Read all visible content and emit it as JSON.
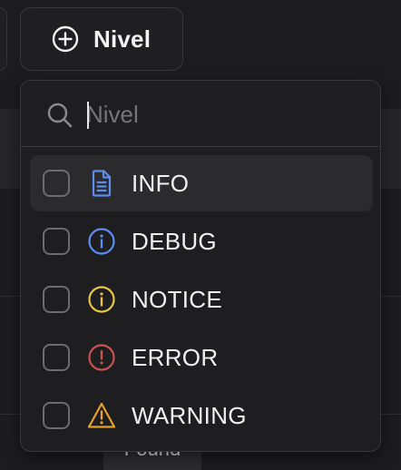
{
  "trigger": {
    "label": "Nivel",
    "icon": "plus-circle-icon"
  },
  "search": {
    "placeholder": "Nivel",
    "value": "",
    "icon": "search-icon"
  },
  "levels": [
    {
      "label": "INFO",
      "icon": "document-icon",
      "color": "#5b8def",
      "checked": false,
      "highlighted": true
    },
    {
      "label": "DEBUG",
      "icon": "info-circle-icon",
      "color": "#5b8def",
      "checked": false,
      "highlighted": false
    },
    {
      "label": "NOTICE",
      "icon": "info-circle-icon",
      "color": "#e8c547",
      "checked": false,
      "highlighted": false
    },
    {
      "label": "ERROR",
      "icon": "alert-circle-icon",
      "color": "#c9524f",
      "checked": false,
      "highlighted": false
    },
    {
      "label": "WARNING",
      "icon": "warning-triangle-icon",
      "color": "#e6a12a",
      "checked": false,
      "highlighted": false
    }
  ],
  "background": {
    "pill_text": "Found"
  },
  "colors": {
    "background": "#1c1c1e",
    "panel": "#1e1e20",
    "border": "#38383b",
    "highlight": "#2b2b2e",
    "text": "#f0f0f0",
    "placeholder": "#76767a"
  }
}
